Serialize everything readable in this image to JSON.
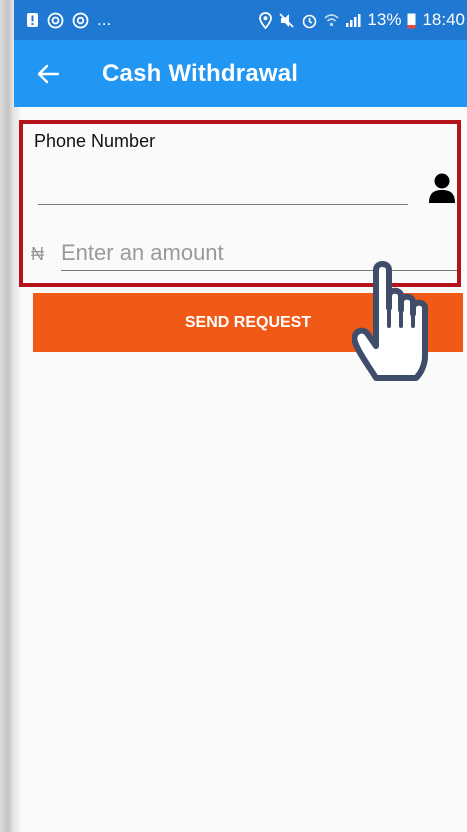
{
  "status_bar": {
    "left_text": "...",
    "battery": "13%",
    "time": "18:40"
  },
  "app_bar": {
    "title": "Cash Withdrawal"
  },
  "form": {
    "phone_label": "Phone Number",
    "phone_value": "",
    "currency_symbol": "₦",
    "amount_placeholder": "Enter an amount",
    "amount_value": "",
    "submit_label": "SEND REQUEST"
  },
  "colors": {
    "status_bar": "#1f78d1",
    "app_bar": "#2196f3",
    "button": "#f15a16",
    "highlight_border": "#b5121b"
  },
  "icons": {
    "back": "arrow-left-icon",
    "contact": "person-icon",
    "pointer": "pointing-hand-icon"
  }
}
